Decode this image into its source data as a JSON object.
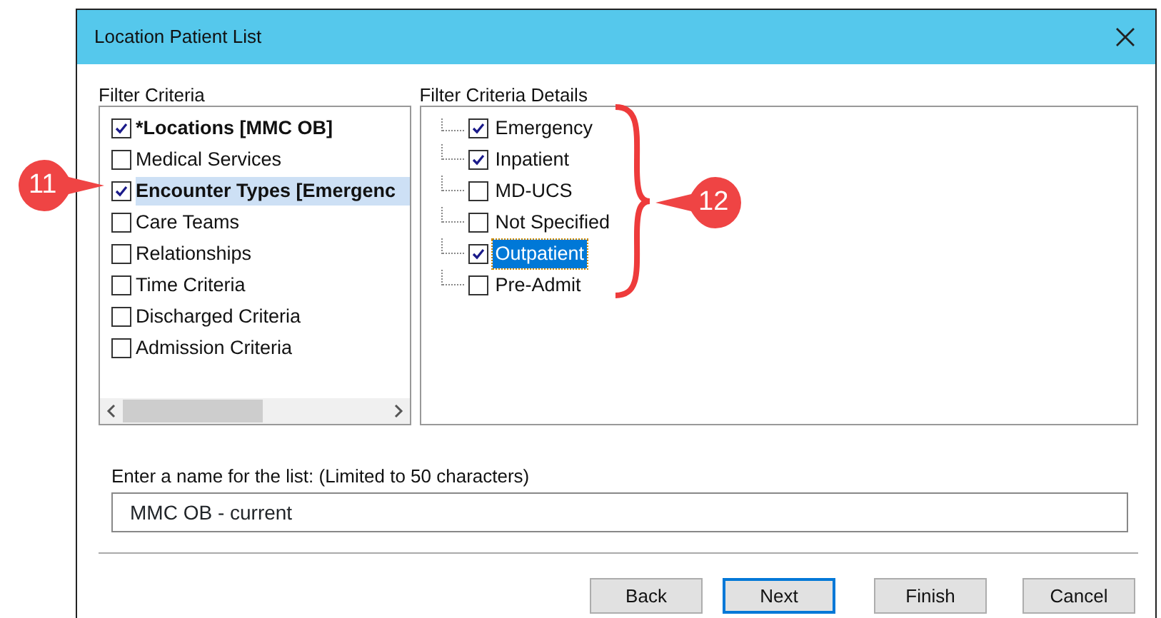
{
  "window": {
    "title": "Location Patient List"
  },
  "filter_criteria": {
    "label": "Filter Criteria",
    "items": [
      {
        "label": "*Locations [MMC OB]",
        "checked": true,
        "bold": true,
        "selected": false
      },
      {
        "label": "Medical Services",
        "checked": false,
        "bold": false,
        "selected": false
      },
      {
        "label": "Encounter Types [Emergenc",
        "checked": true,
        "bold": true,
        "selected": true
      },
      {
        "label": "Care Teams",
        "checked": false,
        "bold": false,
        "selected": false
      },
      {
        "label": "Relationships",
        "checked": false,
        "bold": false,
        "selected": false
      },
      {
        "label": "Time Criteria",
        "checked": false,
        "bold": false,
        "selected": false
      },
      {
        "label": "Discharged Criteria",
        "checked": false,
        "bold": false,
        "selected": false
      },
      {
        "label": "Admission Criteria",
        "checked": false,
        "bold": false,
        "selected": false
      }
    ]
  },
  "details": {
    "label": "Filter Criteria Details",
    "items": [
      {
        "label": "Emergency",
        "checked": true,
        "selected": false
      },
      {
        "label": "Inpatient",
        "checked": true,
        "selected": false
      },
      {
        "label": "MD-UCS",
        "checked": false,
        "selected": false
      },
      {
        "label": "Not Specified",
        "checked": false,
        "selected": false
      },
      {
        "label": "Outpatient",
        "checked": true,
        "selected": true
      },
      {
        "label": "Pre-Admit",
        "checked": false,
        "selected": false
      }
    ]
  },
  "name_field": {
    "label": "Enter a name for the list: (Limited to 50 characters)",
    "value": "MMC OB - current"
  },
  "buttons": [
    {
      "label": "Back",
      "default": false
    },
    {
      "label": "Next",
      "default": true
    },
    {
      "label": "Finish",
      "default": false
    },
    {
      "label": "Cancel",
      "default": false
    }
  ],
  "callouts": [
    {
      "text": "11",
      "kind": "right"
    },
    {
      "text": "12",
      "kind": "left"
    }
  ]
}
